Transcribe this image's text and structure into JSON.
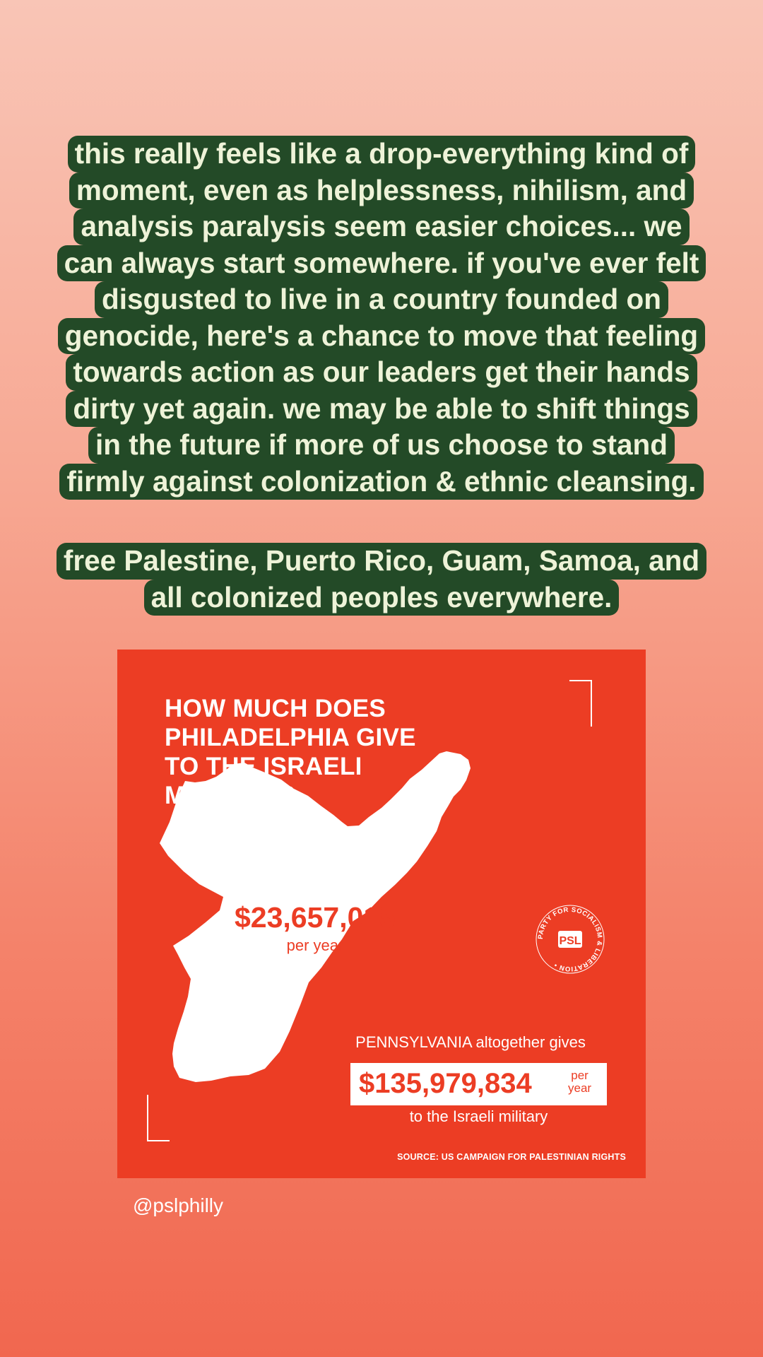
{
  "story_text": {
    "paragraph1_lines": [
      "this really feels like a drop-everything kind of",
      "moment, even as helplessness, nihilism, and",
      "analysis paralysis seem easier choices... we",
      "can always start somewhere. if you've ever felt",
      "disgusted to live in a country founded on",
      "genocide, here's a chance to move that feeling",
      "towards action as our leaders get their hands",
      "dirty yet again. we may be able to shift things",
      "in the future if more of us choose to stand",
      "firmly against colonization & ethnic cleansing."
    ],
    "paragraph2_lines": [
      "free Palestine, Puerto Rico, Guam, Samoa, and",
      "all colonized peoples everywhere."
    ]
  },
  "infographic": {
    "title_lines": [
      "HOW MUCH DOES",
      "PHILADELPHIA GIVE",
      "TO THE ISRAELI",
      "MILITARY?"
    ],
    "city_amount": "$23,657,015",
    "city_amount_period": "per year",
    "state_line": "PENNSYLVANIA altogether gives",
    "state_amount": "$135,979,834",
    "state_per": "per",
    "state_year": "year",
    "state_tail": "to the Israeli military",
    "source": "SOURCE: US CAMPAIGN FOR PALESTINIAN RIGHTS",
    "logo_ring_text": "PARTY FOR SOCIALISM & LIBERATION •",
    "logo_abbr": "PSL",
    "colors": {
      "card_red": "#ec3d24",
      "caption_green": "#234a27",
      "caption_text": "#eef3d8"
    }
  },
  "handle": "@pslphilly"
}
